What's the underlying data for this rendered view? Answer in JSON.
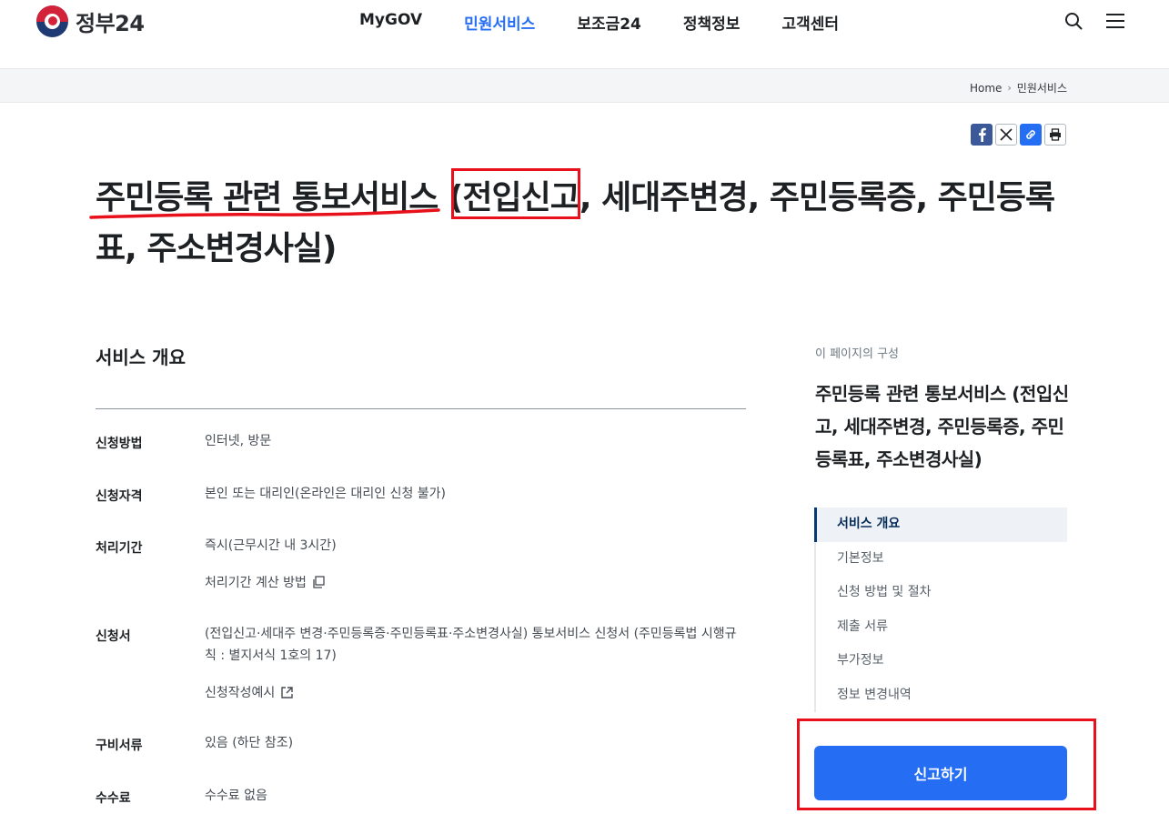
{
  "header": {
    "logo_text": "정부24",
    "nav": [
      {
        "label": "MyGOV",
        "active": false
      },
      {
        "label": "민원서비스",
        "active": true
      },
      {
        "label": "보조금24",
        "active": false
      },
      {
        "label": "정책정보",
        "active": false
      },
      {
        "label": "고객센터",
        "active": false
      }
    ],
    "icons": [
      "search-icon",
      "menu-icon"
    ]
  },
  "breadcrumb": {
    "home": "Home",
    "current": "민원서비스"
  },
  "share_icons": [
    "facebook-icon",
    "x-icon",
    "link-icon",
    "print-icon"
  ],
  "title": {
    "part1": "주민등록 관련 통보서비스 (",
    "highlight": "전입신고",
    "part2": ", 세대주변경, 주민등록증, 주민등록표, 주소변경사실)"
  },
  "overview": {
    "heading": "서비스 개요",
    "rows": [
      {
        "label": "신청방법",
        "value": "인터넷, 방문"
      },
      {
        "label": "신청자격",
        "value": "본인 또는 대리인(온라인은 대리인 신청 불가)"
      },
      {
        "label": "처리기간",
        "value": "즉시(근무시간 내 3시간)",
        "link": "처리기간 계산 방법"
      },
      {
        "label": "신청서",
        "value": "(전입신고·세대주 변경·주민등록증·주민등록표·주소변경사실) 통보서비스 신청서 (주민등록법 시행규칙 : 별지서식 1호의 17)",
        "link": "신청작성예시"
      },
      {
        "label": "구비서류",
        "value": "있음 (하단 참조)"
      },
      {
        "label": "수수료",
        "value": "수수료 없음"
      }
    ]
  },
  "toc": {
    "caption": "이 페이지의 구성",
    "title": "주민등록 관련 통보서비스 (전입신고, 세대주변경, 주민등록증, 주민등록표, 주소변경사실)",
    "items": [
      {
        "label": "서비스 개요",
        "active": true
      },
      {
        "label": "기본정보",
        "active": false
      },
      {
        "label": "신청 방법 및 절차",
        "active": false
      },
      {
        "label": "제출 서류",
        "active": false
      },
      {
        "label": "부가정보",
        "active": false
      },
      {
        "label": "정보 변경내역",
        "active": false
      }
    ],
    "cta": "신고하기"
  },
  "colors": {
    "accent": "#256ef4",
    "annotation": "#e8101a",
    "nav_active": "#256ef4"
  }
}
